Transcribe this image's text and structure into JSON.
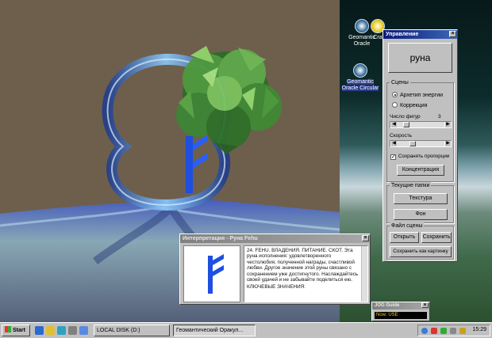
{
  "desktop": {
    "icons": [
      {
        "label_line1": "Geomantic",
        "label_line2": "Oracle"
      },
      {
        "label_line1": "Geomantic",
        "label_line2": "Oracle Circular"
      },
      {
        "label_line1": "Cra",
        "label_line2": ""
      }
    ]
  },
  "control_panel": {
    "title": "Управление",
    "rune_button": "руна",
    "scene_group": "Сцены",
    "radio_archetype": "Архетип энергии",
    "radio_correction": "Коррекция",
    "shapes_label": "Число фигур",
    "shapes_value": "3",
    "shapes_level": 0.15,
    "speed_label": "Скорость",
    "speed_level": 0.3,
    "keep_proportions": "Сохранять пропорции",
    "concentration_button": "Концентрация",
    "folders_group": "Текущие папки",
    "texture_button": "Текстура",
    "background_button": "Фон",
    "scene_file_group": "Файл сцены",
    "open_button": "Открыть",
    "save_button": "Сохранить",
    "save_as_picture_button": "Сохранить как картинку"
  },
  "interpretation": {
    "title": "Интерпретация - Руна Fehu",
    "text": "24. FEHU. ВЛАДЕНИЯ. ПИТАНИЕ. СКОТ. Эта руна исполнения: удовлетворенного честолюбия, полученной награды, счастливой любви. Другое значение этой руны связано с сохранением уже достигнутого. Наслаждайтесь своей удачей и не забывайте поделиться ею.",
    "keywords_label": "КЛЮЧЕВЫЕ ЗНАЧЕНИЯ:"
  },
  "jog_guide": {
    "title": "JOG Guide",
    "status": "Now: USE"
  },
  "taskbar": {
    "start": "Start",
    "items": [
      "LOCAL DISK (D:)",
      "Геомантический Оракул..."
    ],
    "clock": "15:29"
  },
  "colors": {
    "title_active": "#0a1a78",
    "rune_blue": "#1d4fe0",
    "tree_green": "#3f9a3a",
    "scene_brown": "#6e5f4d"
  }
}
